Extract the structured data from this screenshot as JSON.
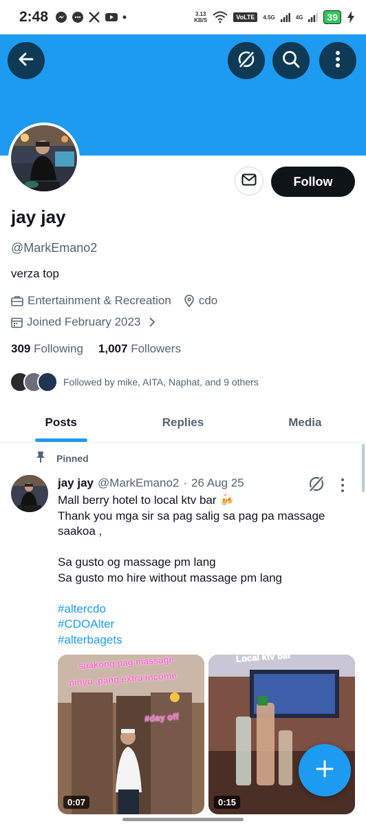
{
  "status_bar": {
    "time": "2:48",
    "left_icons": [
      "messenger-icon",
      "chat-icon",
      "x-icon",
      "youtube-icon",
      "dot-icon"
    ],
    "speed_value": "3.13",
    "speed_unit": "KB/S",
    "volte": "VoLTE",
    "network_1": "4.5G",
    "network_2": "4G",
    "battery": "39"
  },
  "header": {
    "back_icon": "arrow-left-icon",
    "grok_icon": "grok-icon",
    "search_icon": "search-icon",
    "more_icon": "more-vertical-icon",
    "banner_color": "#1d9bf0"
  },
  "profile": {
    "display_name": "jay jay",
    "handle": "@MarkEmano2",
    "bio": "verza top",
    "category": "Entertainment & Recreation",
    "location": "cdo",
    "joined": "Joined February 2023",
    "following_count": "309",
    "following_label": "Following",
    "followers_count": "1,007",
    "followers_label": "Followers",
    "followed_by": "Followed by mike, AITA, Naphat, and 9 others",
    "follow_button": "Follow"
  },
  "tabs": [
    {
      "label": "Posts",
      "active": true
    },
    {
      "label": "Replies",
      "active": false
    },
    {
      "label": "Media",
      "active": false
    }
  ],
  "tweet": {
    "pinned_label": "Pinned",
    "author": "jay jay",
    "handle": "@MarkEmano2",
    "separator": "·",
    "date": "26 Aug 25",
    "lines": [
      "Mall berry hotel to local ktv bar 🍻",
      "Thank you mga sir sa pag salig sa pag pa massage",
      "saakoa ,",
      "",
      "Sa gusto og massage pm lang",
      "Sa gusto mo hire without massage pm lang",
      ""
    ],
    "hashtags": [
      "#altercdo",
      "#CDOAlter",
      "#alterbagets"
    ],
    "media": [
      {
        "duration": "0:07",
        "captions": [
          "saakong pag massage",
          "ninyu ,pang extra income",
          "#day off"
        ]
      },
      {
        "duration": "0:15",
        "captions": [
          "Local ktv bar"
        ]
      }
    ]
  },
  "fab_icon": "plus-icon",
  "colors": {
    "accent": "#1d9bf0",
    "text_primary": "#0f1419",
    "text_secondary": "#536471"
  }
}
